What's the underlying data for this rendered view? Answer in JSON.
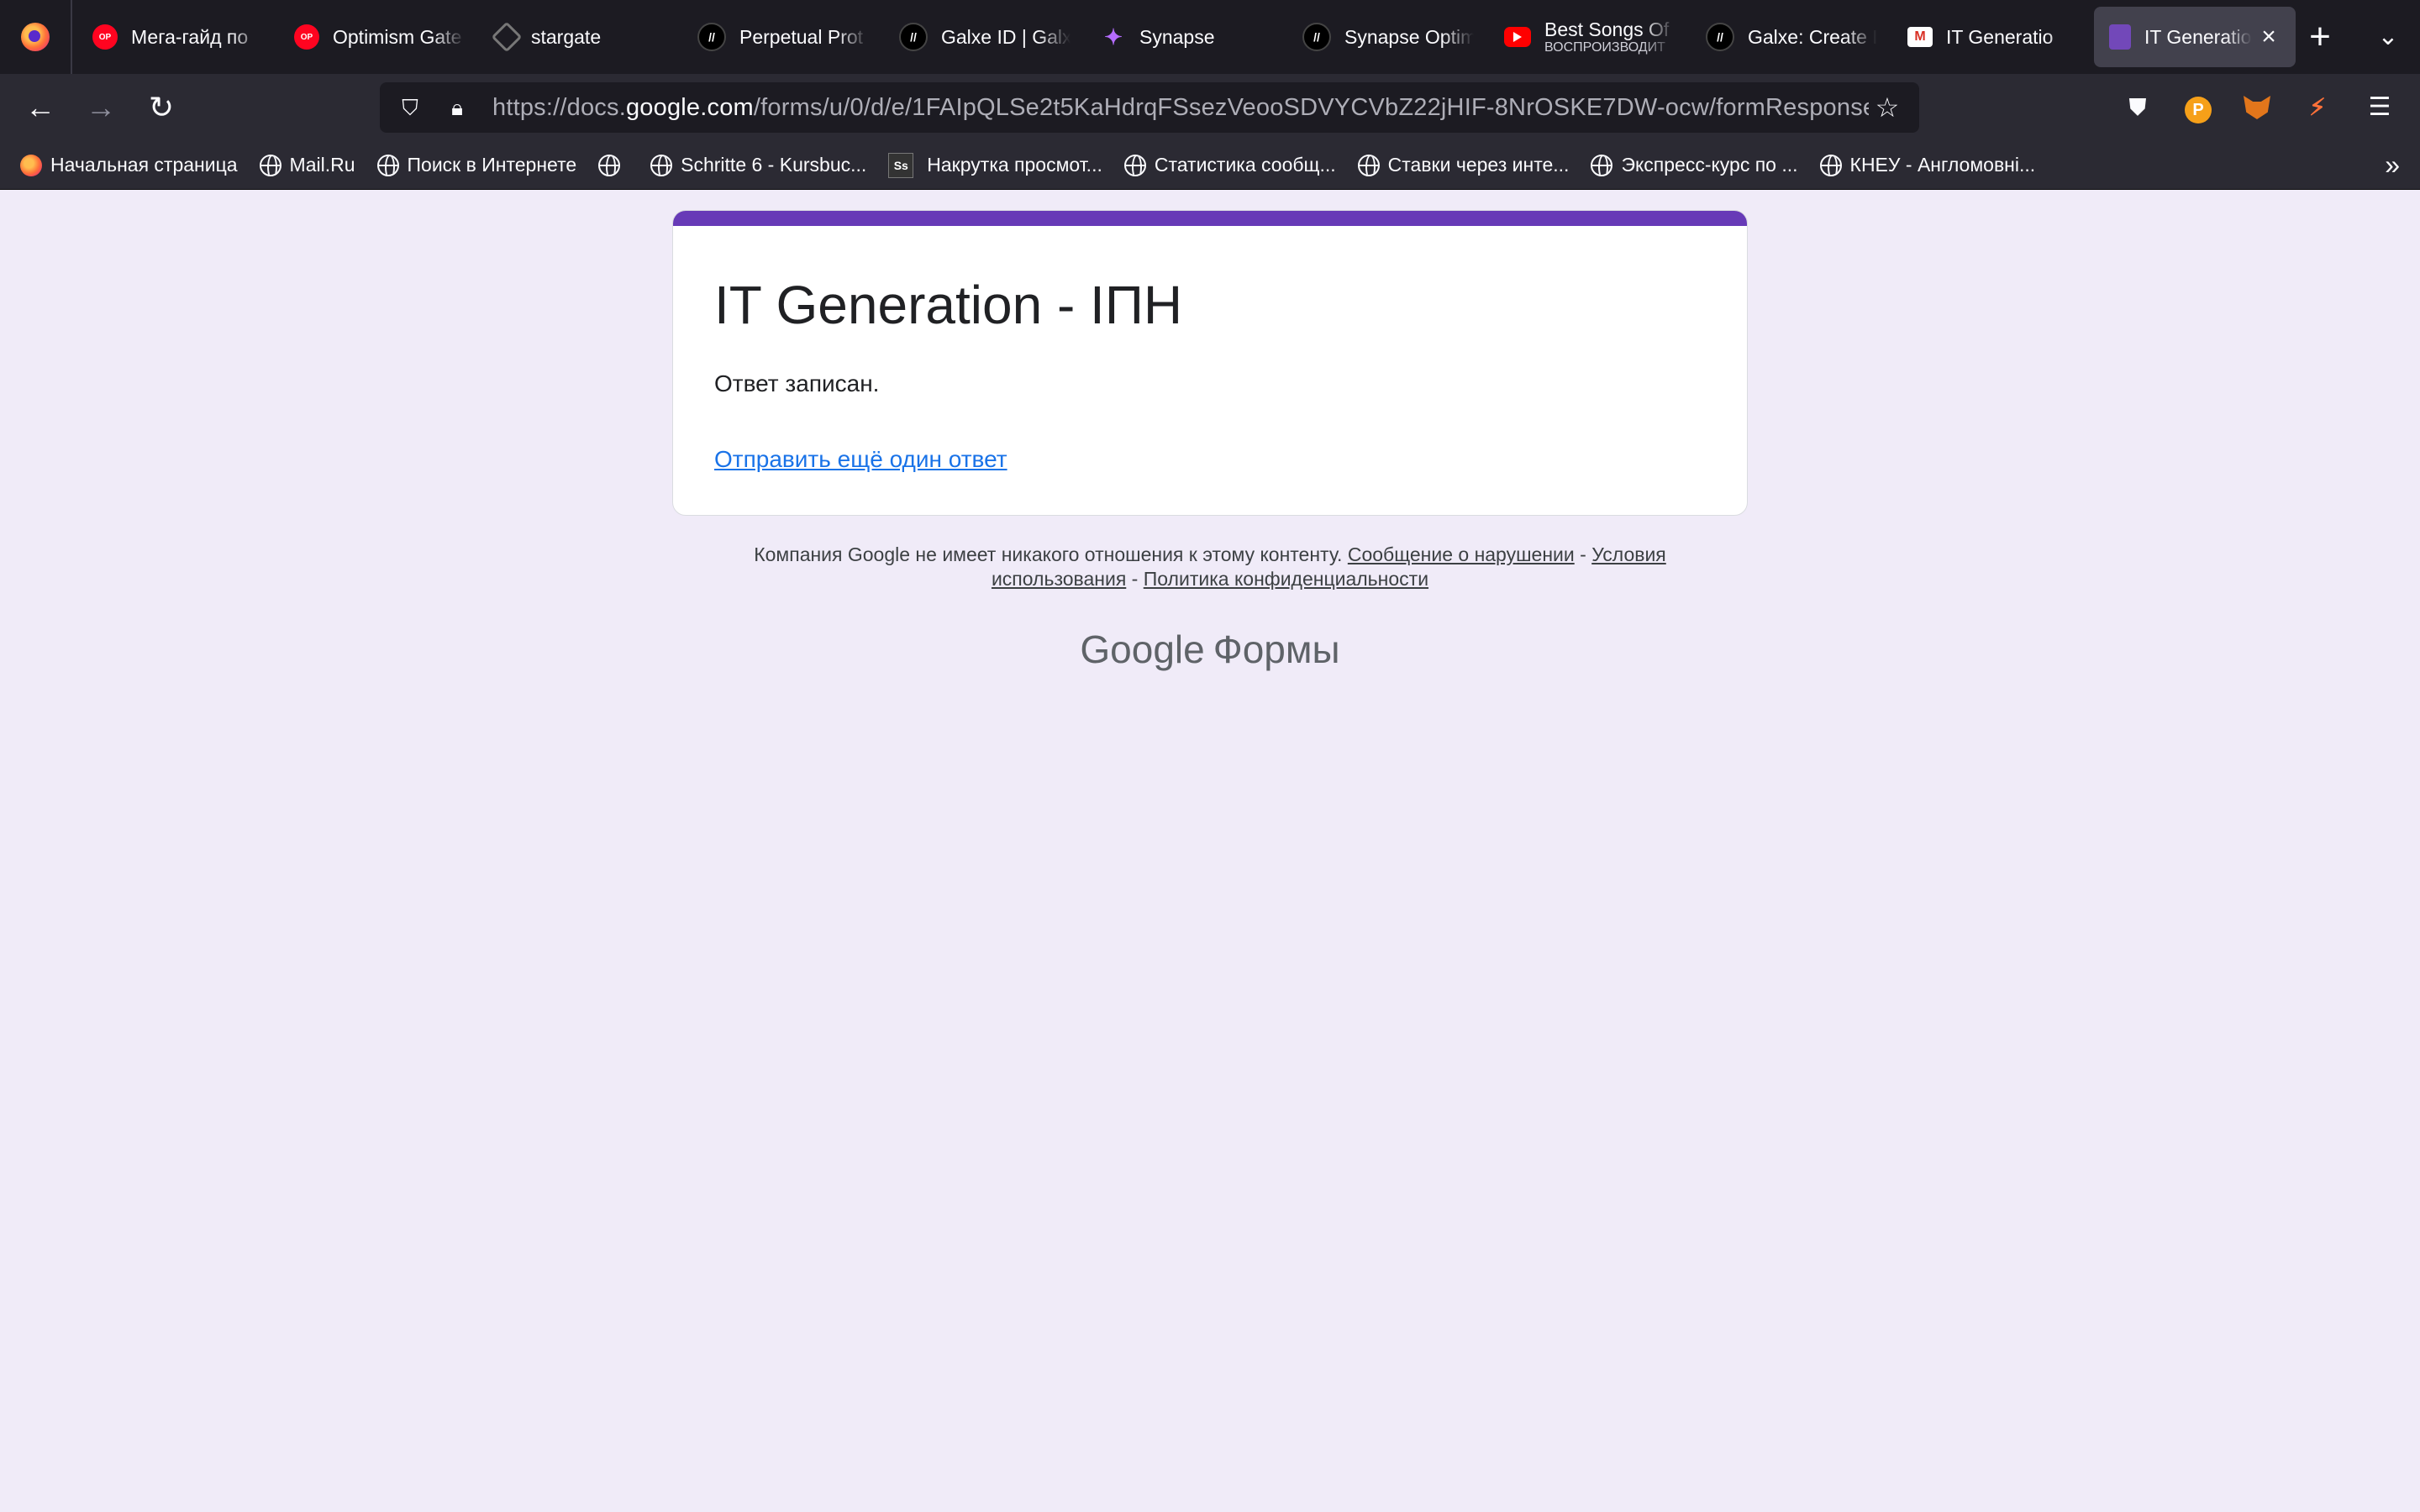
{
  "tabs": [
    {
      "label": "Мега-гайд по",
      "icon": "optimism-icon"
    },
    {
      "label": "Optimism Gate",
      "icon": "optimism-icon"
    },
    {
      "label": "stargate",
      "icon": "stargate-icon"
    },
    {
      "label": "Perpetual Prot",
      "icon": "galxe-icon"
    },
    {
      "label": "Galxe ID | Galx",
      "icon": "galxe-icon"
    },
    {
      "label": "Synapse",
      "icon": "synapse-icon"
    },
    {
      "label": "Synapse Optim",
      "icon": "galxe-icon"
    },
    {
      "label": "Best Songs Of",
      "sublabel": "ВОСПРОИЗВОДИТ",
      "icon": "youtube-icon"
    },
    {
      "label": "Galxe: Create I",
      "icon": "galxe-icon"
    },
    {
      "label": "IT Generatio",
      "icon": "gmail-icon"
    },
    {
      "label": "IT Generatio",
      "icon": "google-forms-icon",
      "active": true
    }
  ],
  "nav": {
    "url_prefix": "https://docs.",
    "url_host": "google.com",
    "url_path": "/forms/u/0/d/e/1FAIpQLSe2t5KaHdrqFSsezVeooSDVYCVbZ22jHIF-8NrOSKE7DW-ocw/formResponse"
  },
  "bookmarks": [
    "Начальная страница",
    "Mail.Ru",
    "Поиск в Интернете",
    "",
    "Schritte 6 - Kursbuc...",
    "Накрутка просмот...",
    "Статистика сообщ...",
    "Ставки через инте...",
    "Экспресс-курс по ...",
    "КНЕУ - Англомовні..."
  ],
  "form": {
    "title": "IT Generation - ІПН",
    "confirmation": "Ответ записан.",
    "another_link": "Отправить ещё один ответ"
  },
  "footer": {
    "disclaimer": "Компания Google не имеет никакого отношения к этому контенту.",
    "report_link": "Сообщение о нарушении",
    "sep1": " - ",
    "terms_link": "Условия использования",
    "sep2": " - ",
    "privacy_link": "Политика конфиденциальности",
    "brand_google": "Google",
    "brand_forms": "Формы"
  },
  "colors": {
    "accent": "#673ab7",
    "page_bg": "#f0ebf8",
    "link": "#1a73e8"
  }
}
